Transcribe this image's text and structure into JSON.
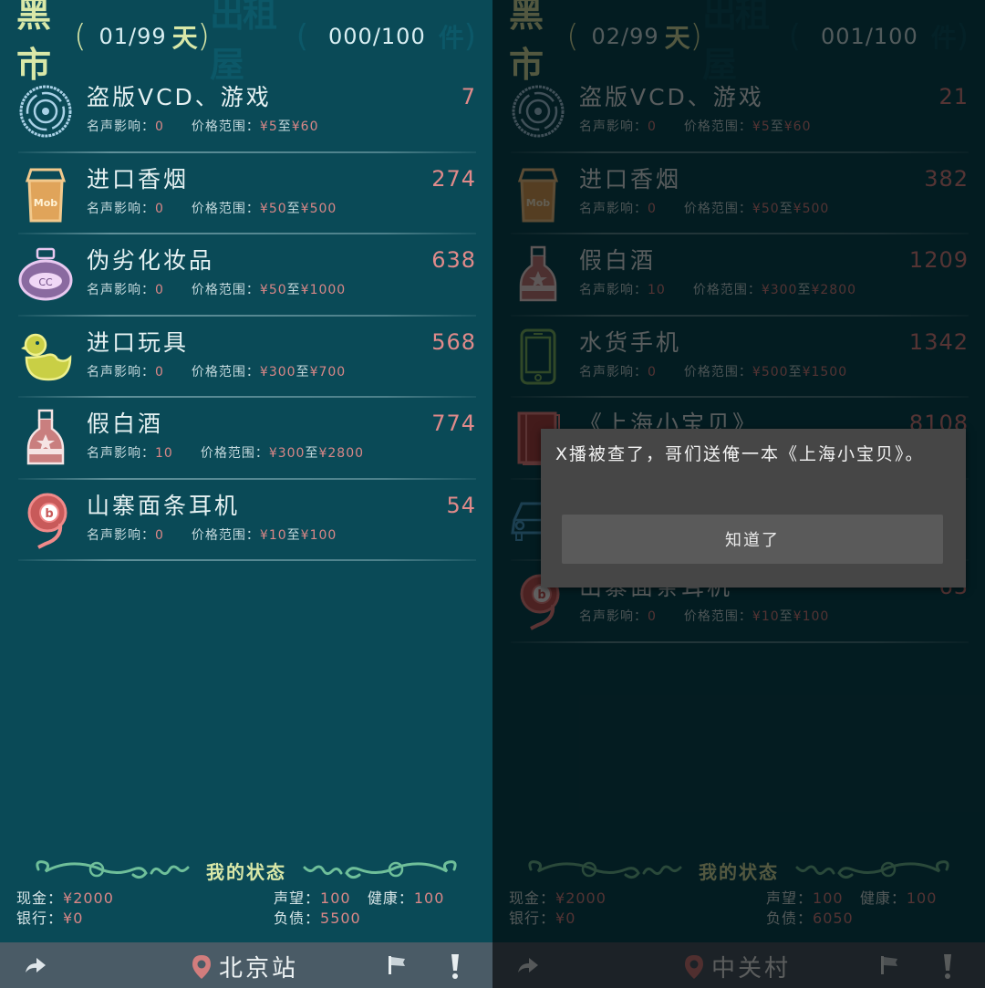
{
  "left": {
    "header": {
      "market_label": "黑市",
      "day_count": "01/99",
      "day_unit": "天",
      "rent_label": "出租屋",
      "storage_count": "000/100",
      "storage_unit": "件"
    },
    "items": [
      {
        "icon": "vcd-disc-icon",
        "name": "盗版VCD、游戏",
        "fame_label": "名声影响：",
        "fame": "0",
        "range_label": "价格范围：",
        "min": "¥5",
        "to": "至",
        "max": "¥60",
        "price": "7"
      },
      {
        "icon": "cigarette-pack-icon",
        "name": "进口香烟",
        "fame_label": "名声影响：",
        "fame": "0",
        "range_label": "价格范围：",
        "min": "¥50",
        "to": "至",
        "max": "¥500",
        "price": "274"
      },
      {
        "icon": "perfume-bottle-icon",
        "name": "伪劣化妆品",
        "fame_label": "名声影响：",
        "fame": "0",
        "range_label": "价格范围：",
        "min": "¥50",
        "to": "至",
        "max": "¥1000",
        "price": "638"
      },
      {
        "icon": "rubber-duck-icon",
        "name": "进口玩具",
        "fame_label": "名声影响：",
        "fame": "0",
        "range_label": "价格范围：",
        "min": "¥300",
        "to": "至",
        "max": "¥700",
        "price": "568"
      },
      {
        "icon": "liquor-bottle-icon",
        "name": "假白酒",
        "fame_label": "名声影响：",
        "fame": "10",
        "range_label": "价格范围：",
        "min": "¥300",
        "to": "至",
        "max": "¥2800",
        "price": "774"
      },
      {
        "icon": "earphone-icon",
        "name": "山寨面条耳机",
        "fame_label": "名声影响：",
        "fame": "0",
        "range_label": "价格范围：",
        "min": "¥10",
        "to": "至",
        "max": "¥100",
        "price": "54"
      }
    ],
    "status": {
      "title": "我的状态",
      "cash_label": "现金：",
      "cash": "¥2000",
      "bank_label": "银行：",
      "bank": "¥0",
      "fame_label": "声望：",
      "fame": "100",
      "health_label": "健康：",
      "health": "100",
      "debt_label": "负债：",
      "debt": "5500"
    },
    "bottombar": {
      "location": "北京站"
    }
  },
  "right": {
    "header": {
      "market_label": "黑市",
      "day_count": "02/99",
      "day_unit": "天",
      "rent_label": "出租屋",
      "storage_count": "001/100",
      "storage_unit": "件"
    },
    "items": [
      {
        "icon": "vcd-disc-icon",
        "name": "盗版VCD、游戏",
        "fame_label": "名声影响：",
        "fame": "0",
        "range_label": "价格范围：",
        "min": "¥5",
        "to": "至",
        "max": "¥60",
        "price": "21"
      },
      {
        "icon": "cigarette-pack-icon",
        "name": "进口香烟",
        "fame_label": "名声影响：",
        "fame": "0",
        "range_label": "价格范围：",
        "min": "¥50",
        "to": "至",
        "max": "¥500",
        "price": "382"
      },
      {
        "icon": "liquor-bottle-icon",
        "name": "假白酒",
        "fame_label": "名声影响：",
        "fame": "10",
        "range_label": "价格范围：",
        "min": "¥300",
        "to": "至",
        "max": "¥2800",
        "price": "1209"
      },
      {
        "icon": "phone-icon",
        "name": "水货手机",
        "fame_label": "名声影响：",
        "fame": "0",
        "range_label": "价格范围：",
        "min": "¥500",
        "to": "至",
        "max": "¥1500",
        "price": "1342"
      },
      {
        "icon": "book-icon",
        "name": "《上海小宝贝》",
        "fame_label": "",
        "fame": "",
        "range_label": "",
        "min": "",
        "to": "",
        "max": "",
        "price": "8108"
      },
      {
        "icon": "car-icon",
        "name": "",
        "fame_label": "",
        "fame": "",
        "range_label": "",
        "min": "",
        "to": "",
        "max": "",
        "price": ""
      },
      {
        "icon": "earphone-icon",
        "name": "山寨面条耳机",
        "fame_label": "名声影响：",
        "fame": "0",
        "range_label": "价格范围：",
        "min": "¥10",
        "to": "至",
        "max": "¥100",
        "price": "63"
      }
    ],
    "status": {
      "title": "我的状态",
      "cash_label": "现金：",
      "cash": "¥2000",
      "bank_label": "银行：",
      "bank": "¥0",
      "fame_label": "声望：",
      "fame": "100",
      "health_label": "健康：",
      "health": "100",
      "debt_label": "负债：",
      "debt": "6050"
    },
    "bottombar": {
      "location": "中关村"
    },
    "dialog": {
      "message": "X播被查了，哥们送俺一本《上海小宝贝》。",
      "button_label": "知道了"
    }
  },
  "colors": {
    "background": "#0a4a57",
    "title_accent": "#d9e8a8",
    "price": "#e08a8a",
    "bottombar": "#4a5b66",
    "dialog": "#464646"
  }
}
